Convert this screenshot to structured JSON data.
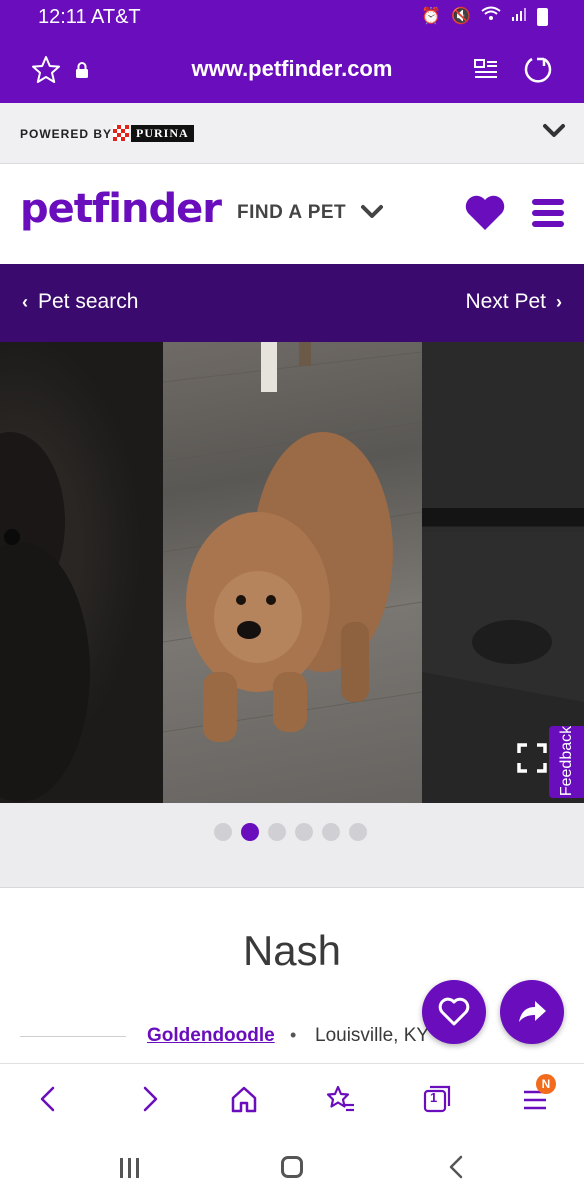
{
  "status_bar": {
    "time": "12:11 AT&T"
  },
  "browser": {
    "url": "www.petfinder.com"
  },
  "powered": {
    "label": "POWERED BY",
    "brand": "PURINA"
  },
  "header": {
    "logo": "petfinder",
    "find_pet_label": "FIND A PET"
  },
  "pet_nav": {
    "back_label": "Pet search",
    "next_label": "Next Pet"
  },
  "carousel": {
    "dot_count": 6,
    "active_index": 1
  },
  "feedback_label": "Feedback",
  "pet": {
    "name": "Nash",
    "breed": "Goldendoodle",
    "separator": "•",
    "location": "Louisville, KY"
  },
  "toolbar": {
    "tabs_count": "1",
    "menu_badge": "N"
  },
  "colors": {
    "brand_purple": "#6a0dbd",
    "nav_dark_purple": "#3b0a6e",
    "badge_orange": "#f26a1b"
  }
}
